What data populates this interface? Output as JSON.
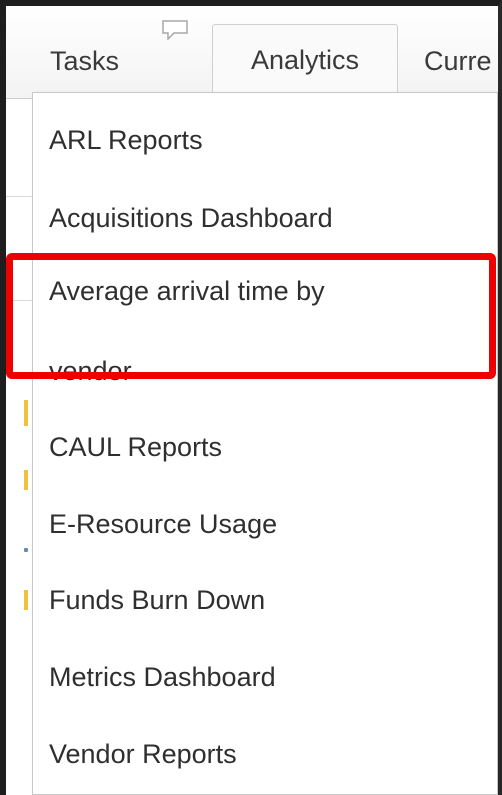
{
  "tabs": [
    {
      "label": "Tasks"
    },
    {
      "label": "Analytics"
    },
    {
      "label": "Curre"
    }
  ],
  "icons": {
    "comment": "comment-icon"
  },
  "analytics_menu": {
    "items": [
      {
        "label": "ARL Reports"
      },
      {
        "label": "Acquisitions Dashboard"
      },
      {
        "label": "Average arrival time by"
      },
      {
        "label": "vendor"
      },
      {
        "label": "CAUL Reports"
      },
      {
        "label": "E-Resource Usage"
      },
      {
        "label": "Funds Burn Down"
      },
      {
        "label": "Metrics Dashboard"
      },
      {
        "label": "Vendor Reports"
      }
    ]
  },
  "highlight": {
    "color": "#ee0000"
  }
}
